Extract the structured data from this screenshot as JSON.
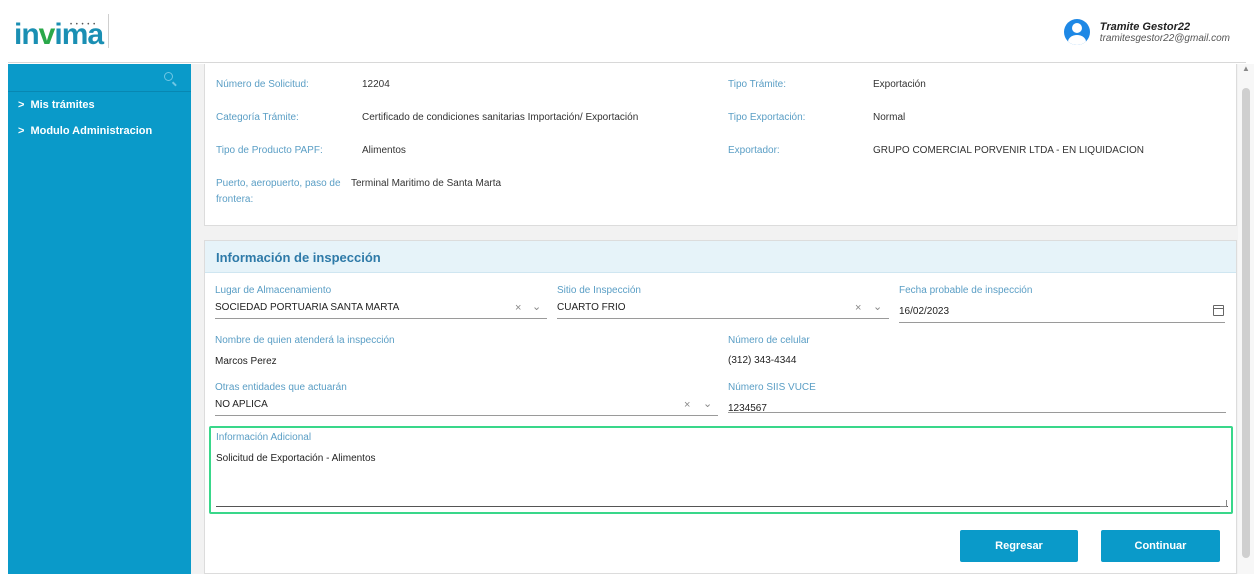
{
  "header": {
    "logo_text": "invima",
    "user_name": "Tramite Gestor22",
    "user_email": "tramitesgestor22@gmail.com"
  },
  "sidebar": {
    "items": [
      {
        "label": "Mis trámites"
      },
      {
        "label": "Modulo Administracion"
      }
    ]
  },
  "summary": {
    "numero_solicitud_label": "Número de Solicitud:",
    "numero_solicitud": "12204",
    "tipo_tramite_label": "Tipo Trámite:",
    "tipo_tramite": "Exportación",
    "categoria_label": "Categoría Trámite:",
    "categoria": "Certificado de condiciones sanitarias Importación/ Exportación",
    "tipo_exportacion_label": "Tipo Exportación:",
    "tipo_exportacion": "Normal",
    "tipo_producto_label": "Tipo de Producto PAPF:",
    "tipo_producto": "Alimentos",
    "exportador_label": "Exportador:",
    "exportador": "GRUPO COMERCIAL PORVENIR LTDA - EN LIQUIDACION",
    "puerto_label_1": "Puerto, aeropuerto, paso de",
    "puerto_label_2": "frontera:",
    "puerto": "Terminal Maritimo de Santa Marta"
  },
  "inspection": {
    "title": "Información de inspección",
    "lugar_label": "Lugar de Almacenamiento",
    "lugar_value": "SOCIEDAD PORTUARIA SANTA MARTA",
    "sitio_label": "Sitio de Inspección",
    "sitio_value": "CUARTO FRIO",
    "fecha_label": "Fecha probable de inspección",
    "fecha_value": "16/02/2023",
    "nombre_label": "Nombre de quien atenderá la inspección",
    "nombre_value": "Marcos Perez",
    "celular_label": "Número de celular",
    "celular_value": "(312) 343-4344",
    "otras_label": "Otras entidades que actuarán",
    "otras_value": "NO APLICA",
    "siis_label": "Número SIIS VUCE",
    "siis_value": "1234567",
    "adicional_label": "Información Adicional",
    "adicional_value": "Solicitud de Exportación - Alimentos"
  },
  "buttons": {
    "back_label": "Regresar",
    "next_label": "Continuar"
  },
  "colors": {
    "primary": "#0a9ac9",
    "focus": "#39d78a",
    "label": "#5a9ec5"
  }
}
